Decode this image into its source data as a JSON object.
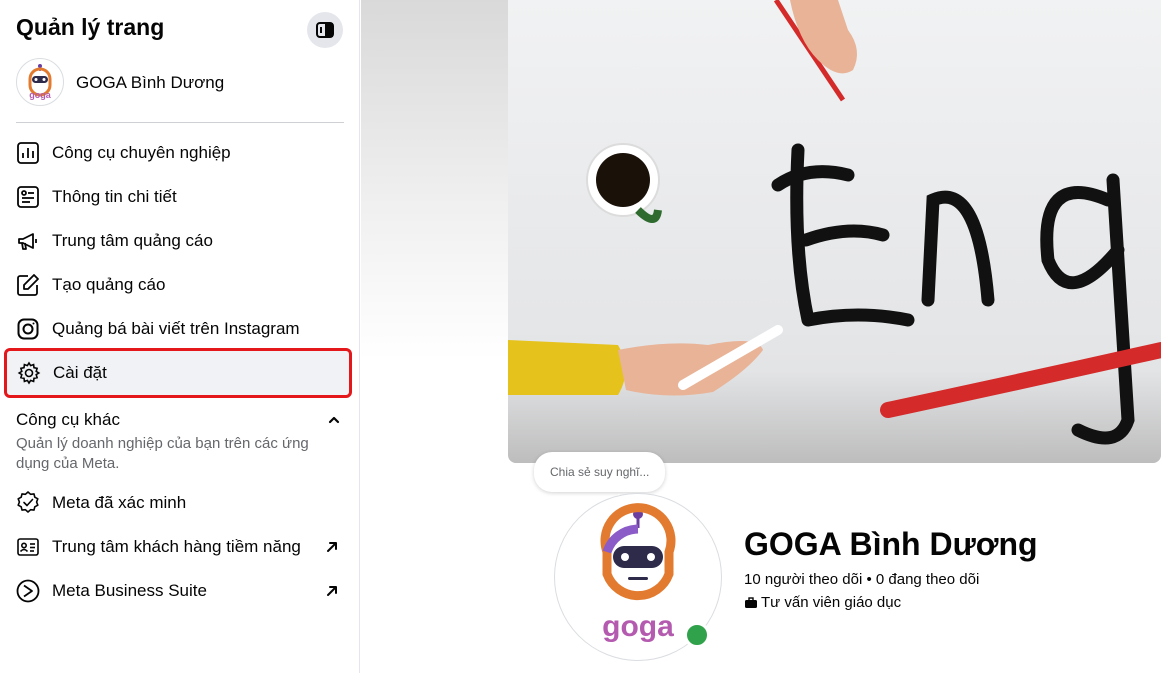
{
  "sidebar": {
    "title": "Quản lý trang",
    "page_name": "GOGA Bình Dương",
    "menu": [
      {
        "label": "Công cụ chuyên nghiệp",
        "icon": "bar-chart-icon"
      },
      {
        "label": "Thông tin chi tiết",
        "icon": "insights-icon"
      },
      {
        "label": "Trung tâm quảng cáo",
        "icon": "megaphone-icon"
      },
      {
        "label": "Tạo quảng cáo",
        "icon": "pencil-icon"
      },
      {
        "label": "Quảng bá bài viết trên Instagram",
        "icon": "instagram-icon"
      },
      {
        "label": "Cài đặt",
        "icon": "gear-icon",
        "highlighted": true
      }
    ],
    "other_tools": {
      "title": "Công cụ khác",
      "subtitle": "Quản lý doanh nghiệp của bạn trên các ứng dụng của Meta.",
      "items": [
        {
          "label": "Meta đã xác minh",
          "icon": "verified-icon"
        },
        {
          "label": "Trung tâm khách hàng tiềm năng",
          "icon": "id-card-icon",
          "external": true
        },
        {
          "label": "Meta Business Suite",
          "icon": "meta-business-icon",
          "external": true
        }
      ]
    }
  },
  "profile": {
    "bubble": "Chia sẻ suy nghĩ...",
    "name": "GOGA Bình Dương",
    "stats": "10 người theo dõi • 0 đang theo dõi",
    "category": "Tư vấn viên giáo dục",
    "logo_text": "goga",
    "online": true
  },
  "colors": {
    "highlight_border": "#e4171b",
    "online": "#31a24c",
    "secondary_text": "#65676b"
  }
}
